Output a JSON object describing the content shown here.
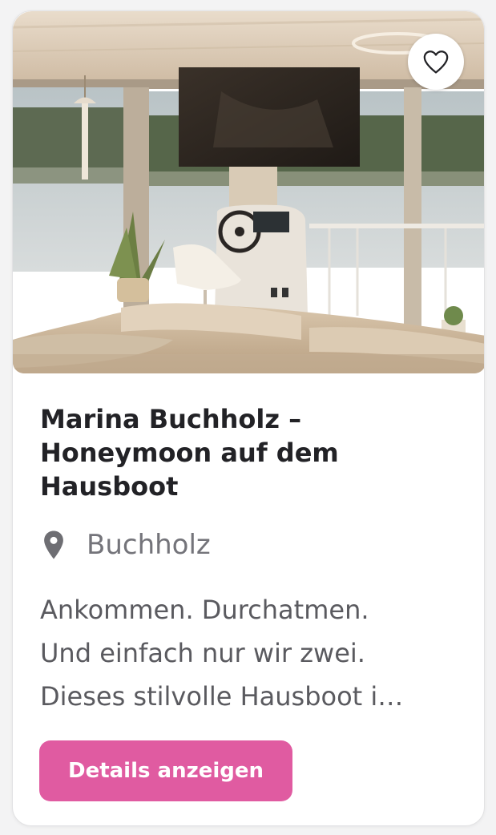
{
  "listing": {
    "image": "houseboat-interior-photo",
    "favorite_icon": "heart-outline-icon",
    "title_line1": "Marina Buchholz –",
    "title_line2": "Honeymoon auf dem",
    "title_line3": "Hausboot",
    "location_icon": "map-pin-icon",
    "location": "Buchholz",
    "description_line1": "Ankommen. Durchatmen.",
    "description_line2": "Und einfach nur wir zwei.",
    "description_line3": "Dieses stilvolle Hausboot i…",
    "button_label": "Details anzeigen"
  },
  "colors": {
    "accent": "#e05ba1",
    "title": "#222226",
    "muted": "#74747a",
    "card_bg": "#ffffff"
  }
}
